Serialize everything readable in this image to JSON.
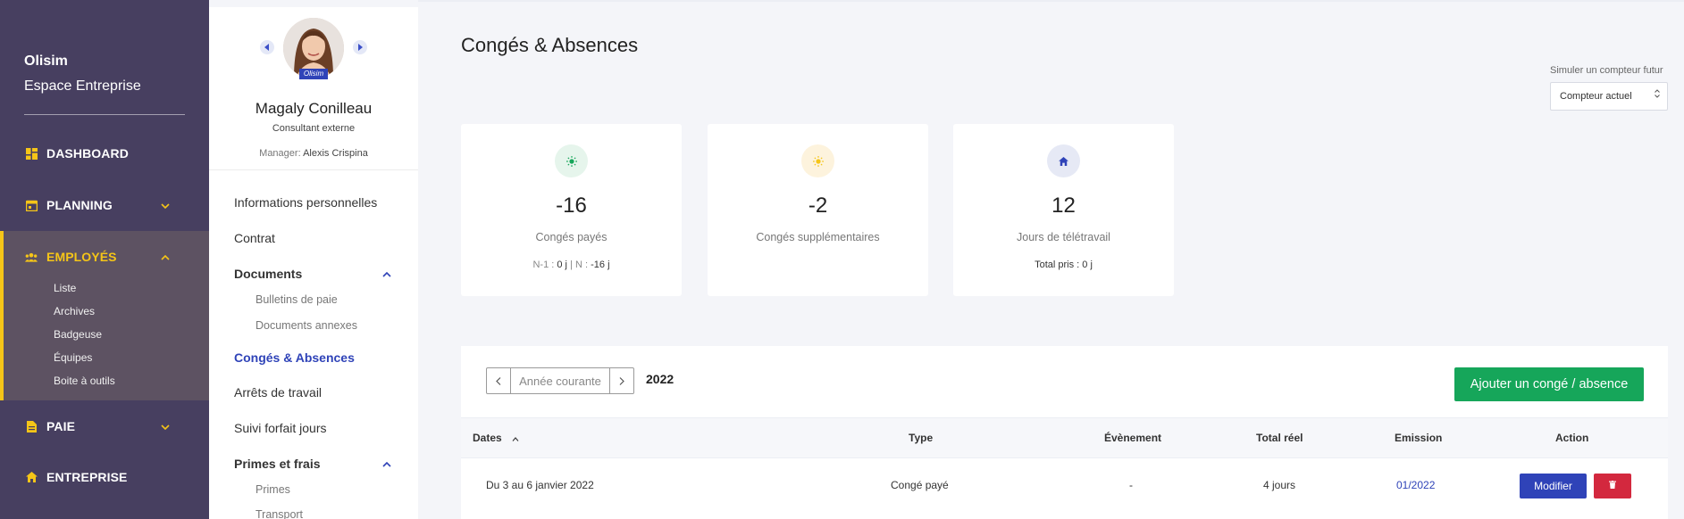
{
  "sidebar": {
    "brand_name": "Olisim",
    "brand_sub": "Espace Entreprise",
    "nav": {
      "dashboard": "DASHBOARD",
      "planning": "PLANNING",
      "employes": "EMPLOYÉS",
      "paie": "PAIE",
      "entreprise": "ENTREPRISE"
    },
    "employes_sub": [
      "Liste",
      "Archives",
      "Badgeuse",
      "Équipes",
      "Boite à outils"
    ],
    "accent_color": "#f5c518",
    "icons": {
      "dashboard": "dashboard-icon",
      "planning": "calendar-icon",
      "employes": "users-icon",
      "paie": "document-icon",
      "entreprise": "home-icon"
    }
  },
  "profile": {
    "badge": "Olisim",
    "name": "Magaly Conilleau",
    "role": "Consultant externe",
    "manager_label": "Manager:",
    "manager_name": "Alexis Crispina",
    "menu": {
      "infos": "Informations personnelles",
      "contrat": "Contrat",
      "documents": "Documents",
      "bulletins": "Bulletins de paie",
      "annexes": "Documents annexes",
      "conges": "Congés & Absences",
      "arrets": "Arrêts de travail",
      "forfait": "Suivi forfait jours",
      "primes_frais": "Primes et frais",
      "primes": "Primes",
      "transport": "Transport"
    }
  },
  "main": {
    "title": "Congés & Absences",
    "simulate_label": "Simuler un compteur futur",
    "simulate_value": "Compteur actuel",
    "cards": [
      {
        "value": "-16",
        "label": "Congés payés",
        "foot_n1_label": "N-1 :",
        "foot_n1_value": "0 j",
        "foot_sep": "|",
        "foot_n_label": "N :",
        "foot_n_value": "-16 j",
        "icon": "sun-icon",
        "icon_bg": "#e6f5ec",
        "icon_color": "#16a65a"
      },
      {
        "value": "-2",
        "label": "Congés supplémentaires",
        "icon": "sun-icon",
        "icon_bg": "#fdf3dd",
        "icon_color": "#f5c518"
      },
      {
        "value": "12",
        "label": "Jours de télétravail",
        "foot": "Total pris : 0 j",
        "icon": "home-icon",
        "icon_bg": "#e6e9f5",
        "icon_color": "#2f43b8"
      }
    ],
    "year_nav": {
      "current_label": "Année courante",
      "year": "2022"
    },
    "add_button": "Ajouter un congé / absence",
    "table": {
      "headers": {
        "dates": "Dates",
        "type": "Type",
        "evenement": "Évènement",
        "total": "Total réel",
        "emission": "Emission",
        "action": "Action"
      },
      "rows": [
        {
          "dates": "Du 3 au 6 janvier 2022",
          "type": "Congé payé",
          "evenement": "-",
          "total": "4 jours",
          "emission": "01/2022",
          "modify_label": "Modifier"
        }
      ]
    }
  }
}
